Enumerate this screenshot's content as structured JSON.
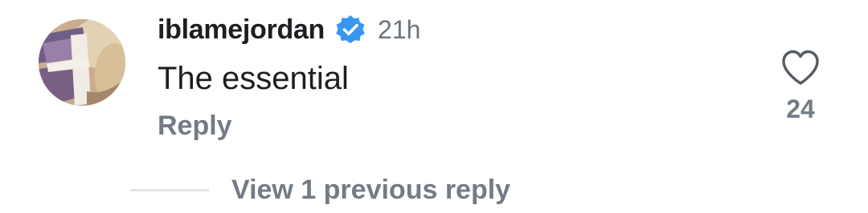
{
  "comment": {
    "avatar_icon": "user-avatar",
    "username": "iblamejordan",
    "verified_icon": "verified-badge-icon",
    "verified_color": "#3897f0",
    "timestamp": "21h",
    "text": "The essential",
    "reply_label": "Reply",
    "like_icon": "heart-outline-icon",
    "like_count": "24",
    "view_replies_label": "View 1 previous reply"
  }
}
